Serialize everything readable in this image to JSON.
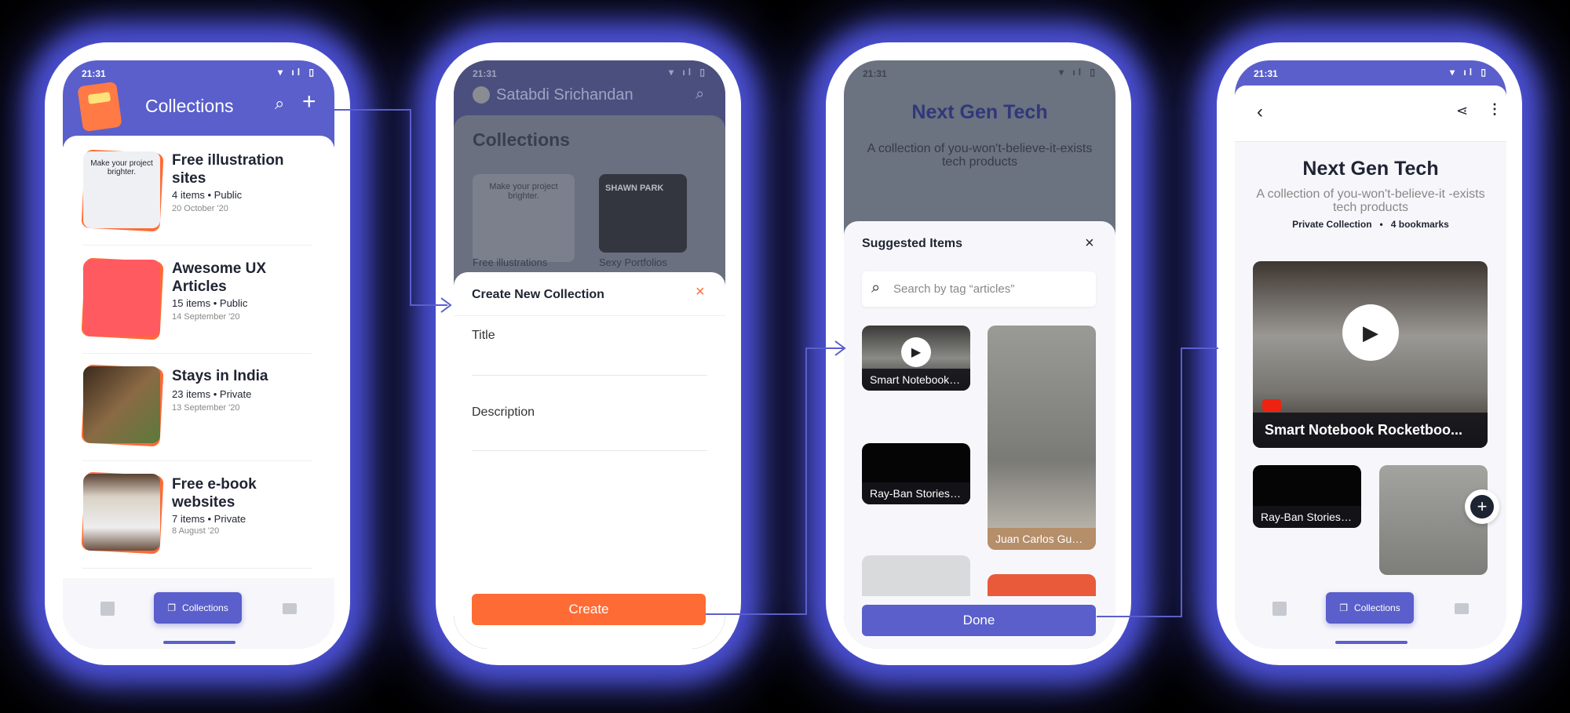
{
  "colors": {
    "accent": "#5a5fcb",
    "orange": "#ff6b35",
    "glow": "#4a4fd0"
  },
  "status": {
    "time": "21:31",
    "icons": [
      "wifi-icon",
      "signal-icon",
      "battery-icon"
    ]
  },
  "screen1": {
    "header_title": "Collections",
    "items": [
      {
        "title": "Free illustration sites",
        "meta": "4 items • Public",
        "date": "20 October '20",
        "thumb_text": "Make your project brighter."
      },
      {
        "title": "Awesome UX Articles",
        "meta": "15 items • Public",
        "date": "14 September '20"
      },
      {
        "title": "Stays in India",
        "meta": "23 items • Private",
        "date": "13 September '20"
      },
      {
        "title": "Free e-book websites",
        "meta": "7 items • Private",
        "date": "8 August '20"
      }
    ],
    "nav": {
      "active_label": "Collections"
    }
  },
  "screen2": {
    "user_name": "Satabdi Srichandan",
    "bg_title": "Collections",
    "bg_cards": [
      {
        "label": "Free illustrations",
        "thumb_text": "Make your project brighter."
      },
      {
        "label": "Sexy Portfolios",
        "thumb_text": "SHAWN PARK"
      }
    ],
    "sheet_title": "Create New Collection",
    "title_placeholder": "Title",
    "description_placeholder": "Description",
    "create_label": "Create"
  },
  "screen3": {
    "bg_title": "Next Gen Tech",
    "bg_description": "A collection of you-won't-believe-it-exists tech products",
    "sheet_title": "Suggested Items",
    "search_placeholder": "Search by tag “articles”",
    "items": [
      {
        "caption": "Smart Notebook R...",
        "source": "youtube"
      },
      {
        "caption": "Ray-Ban Stories S...",
        "source": "rayban"
      },
      {
        "caption": "Juan Carlos Guáq...",
        "source": "linkedin"
      }
    ],
    "done_label": "Done"
  },
  "screen4": {
    "title": "Next Gen Tech",
    "description": "A collection of you-won't-believe-it -exists tech products",
    "privacy": "Private Collection",
    "count": "4 bookmarks",
    "featured_caption": "Smart Notebook Rocketboo...",
    "items": [
      {
        "caption": "Ray-Ban Stories S..."
      }
    ],
    "nav": {
      "active_label": "Collections"
    }
  }
}
